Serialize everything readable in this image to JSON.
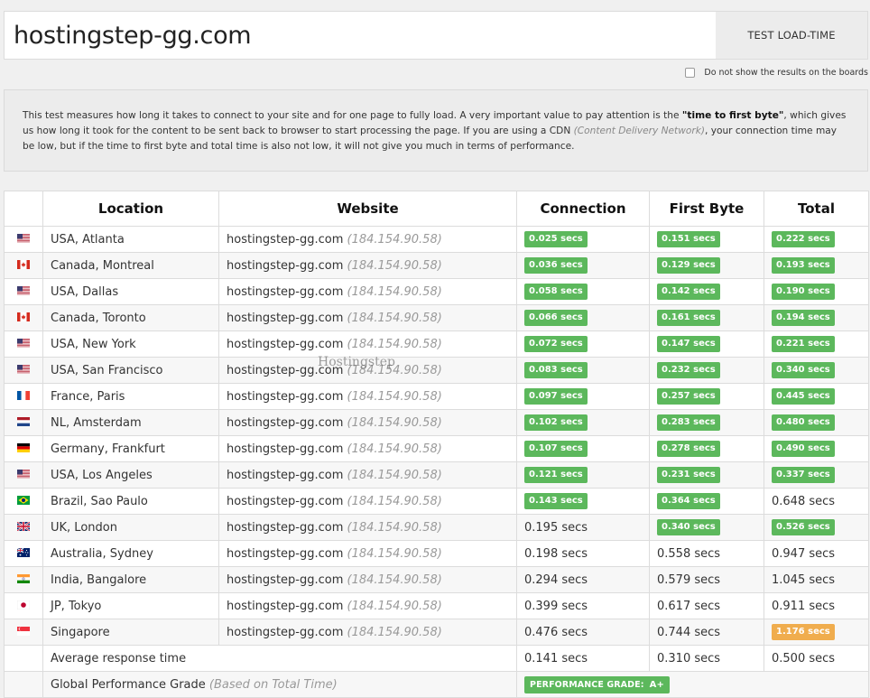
{
  "search": {
    "value": "hostingstep-gg.com",
    "button_label": "TEST LOAD-TIME"
  },
  "options": {
    "hide_results_label": "Do not show the results on the boards",
    "hide_results_checked": false
  },
  "description": {
    "part1": "This test measures how long it takes to connect to your site and for one page to fully load. A very important value to pay attention is the ",
    "bold": "\"time to first byte\"",
    "part2": ", which gives us how long it took for the content to be sent back to browser to start processing the page. If you are using a CDN ",
    "italic": "(Content Delivery Network)",
    "part3": ", your connection time may be low, but if the time to first byte and total time is also not low, it will not give you much in terms of performance."
  },
  "table": {
    "headers": {
      "location": "Location",
      "website": "Website",
      "connection": "Connection",
      "first_byte": "First Byte",
      "total": "Total"
    },
    "rows": [
      {
        "flag": "us",
        "location": "USA, Atlanta",
        "site": "hostingstep-gg.com",
        "ip": "(184.154.90.58)",
        "connection": "0.025 secs",
        "connection_status": "green",
        "first_byte": "0.151 secs",
        "first_byte_status": "green",
        "total": "0.222 secs",
        "total_status": "green"
      },
      {
        "flag": "ca",
        "location": "Canada, Montreal",
        "site": "hostingstep-gg.com",
        "ip": "(184.154.90.58)",
        "connection": "0.036 secs",
        "connection_status": "green",
        "first_byte": "0.129 secs",
        "first_byte_status": "green",
        "total": "0.193 secs",
        "total_status": "green"
      },
      {
        "flag": "us",
        "location": "USA, Dallas",
        "site": "hostingstep-gg.com",
        "ip": "(184.154.90.58)",
        "connection": "0.058 secs",
        "connection_status": "green",
        "first_byte": "0.142 secs",
        "first_byte_status": "green",
        "total": "0.190 secs",
        "total_status": "green"
      },
      {
        "flag": "ca",
        "location": "Canada, Toronto",
        "site": "hostingstep-gg.com",
        "ip": "(184.154.90.58)",
        "connection": "0.066 secs",
        "connection_status": "green",
        "first_byte": "0.161 secs",
        "first_byte_status": "green",
        "total": "0.194 secs",
        "total_status": "green"
      },
      {
        "flag": "us",
        "location": "USA, New York",
        "site": "hostingstep-gg.com",
        "ip": "(184.154.90.58)",
        "connection": "0.072 secs",
        "connection_status": "green",
        "first_byte": "0.147 secs",
        "first_byte_status": "green",
        "total": "0.221 secs",
        "total_status": "green"
      },
      {
        "flag": "us",
        "location": "USA, San Francisco",
        "site": "hostingstep-gg.com",
        "ip": "(184.154.90.58)",
        "connection": "0.083 secs",
        "connection_status": "green",
        "first_byte": "0.232 secs",
        "first_byte_status": "green",
        "total": "0.340 secs",
        "total_status": "green"
      },
      {
        "flag": "fr",
        "location": "France, Paris",
        "site": "hostingstep-gg.com",
        "ip": "(184.154.90.58)",
        "connection": "0.097 secs",
        "connection_status": "green",
        "first_byte": "0.257 secs",
        "first_byte_status": "green",
        "total": "0.445 secs",
        "total_status": "green"
      },
      {
        "flag": "nl",
        "location": "NL, Amsterdam",
        "site": "hostingstep-gg.com",
        "ip": "(184.154.90.58)",
        "connection": "0.102 secs",
        "connection_status": "green",
        "first_byte": "0.283 secs",
        "first_byte_status": "green",
        "total": "0.480 secs",
        "total_status": "green"
      },
      {
        "flag": "de",
        "location": "Germany, Frankfurt",
        "site": "hostingstep-gg.com",
        "ip": "(184.154.90.58)",
        "connection": "0.107 secs",
        "connection_status": "green",
        "first_byte": "0.278 secs",
        "first_byte_status": "green",
        "total": "0.490 secs",
        "total_status": "green"
      },
      {
        "flag": "us",
        "location": "USA, Los Angeles",
        "site": "hostingstep-gg.com",
        "ip": "(184.154.90.58)",
        "connection": "0.121 secs",
        "connection_status": "green",
        "first_byte": "0.231 secs",
        "first_byte_status": "green",
        "total": "0.337 secs",
        "total_status": "green"
      },
      {
        "flag": "br",
        "location": "Brazil, Sao Paulo",
        "site": "hostingstep-gg.com",
        "ip": "(184.154.90.58)",
        "connection": "0.143 secs",
        "connection_status": "green",
        "first_byte": "0.364 secs",
        "first_byte_status": "green",
        "total": "0.648 secs",
        "total_status": "plain"
      },
      {
        "flag": "uk",
        "location": "UK, London",
        "site": "hostingstep-gg.com",
        "ip": "(184.154.90.58)",
        "connection": "0.195 secs",
        "connection_status": "plain",
        "first_byte": "0.340 secs",
        "first_byte_status": "green",
        "total": "0.526 secs",
        "total_status": "green"
      },
      {
        "flag": "au",
        "location": "Australia, Sydney",
        "site": "hostingstep-gg.com",
        "ip": "(184.154.90.58)",
        "connection": "0.198 secs",
        "connection_status": "plain",
        "first_byte": "0.558 secs",
        "first_byte_status": "plain",
        "total": "0.947 secs",
        "total_status": "plain"
      },
      {
        "flag": "in",
        "location": "India, Bangalore",
        "site": "hostingstep-gg.com",
        "ip": "(184.154.90.58)",
        "connection": "0.294 secs",
        "connection_status": "plain",
        "first_byte": "0.579 secs",
        "first_byte_status": "plain",
        "total": "1.045 secs",
        "total_status": "plain"
      },
      {
        "flag": "jp",
        "location": "JP, Tokyo",
        "site": "hostingstep-gg.com",
        "ip": "(184.154.90.58)",
        "connection": "0.399 secs",
        "connection_status": "plain",
        "first_byte": "0.617 secs",
        "first_byte_status": "plain",
        "total": "0.911 secs",
        "total_status": "plain"
      },
      {
        "flag": "sg",
        "location": "Singapore",
        "site": "hostingstep-gg.com",
        "ip": "(184.154.90.58)",
        "connection": "0.476 secs",
        "connection_status": "plain",
        "first_byte": "0.744 secs",
        "first_byte_status": "plain",
        "total": "1.176 secs",
        "total_status": "orange"
      }
    ],
    "average": {
      "label": "Average response time",
      "connection": "0.141 secs",
      "first_byte": "0.310 secs",
      "total": "0.500 secs"
    },
    "grade": {
      "label": "Global Performance Grade",
      "note": "(Based on Total Time)",
      "badge_label": "PERFORMANCE GRADE:",
      "badge_value": "A+"
    }
  },
  "watermark": "Hostingstep",
  "colors": {
    "good": "#5cb85c",
    "warn": "#f0ad4e"
  }
}
